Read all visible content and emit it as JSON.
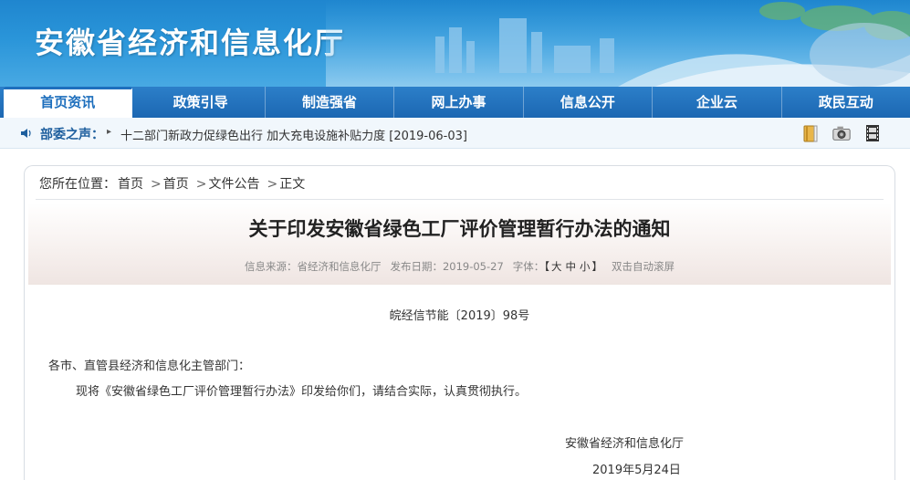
{
  "header": {
    "site_title": "安徽省经济和信息化厅"
  },
  "nav": {
    "items": [
      {
        "label": "首页资讯",
        "active": true
      },
      {
        "label": "政策引导",
        "active": false
      },
      {
        "label": "制造强省",
        "active": false
      },
      {
        "label": "网上办事",
        "active": false
      },
      {
        "label": "信息公开",
        "active": false
      },
      {
        "label": "企业云",
        "active": false
      },
      {
        "label": "政民互动",
        "active": false
      }
    ]
  },
  "ticker": {
    "label": "部委之声：",
    "arrow": "▸",
    "headline": "十二部门新政力促绿色出行 加大充电设施补贴力度 [2019-06-03]",
    "tools": [
      "book-icon",
      "camera-icon",
      "film-icon"
    ]
  },
  "breadcrumb": {
    "prefix": "您所在位置：",
    "items": [
      "首页",
      "首页",
      "文件公告",
      "正文"
    ],
    "separator": ">"
  },
  "article": {
    "title": "关于印发安徽省绿色工厂评价管理暂行办法的通知",
    "meta": {
      "source_label": "信息来源：",
      "source": "省经济和信息化厅",
      "date_label": "发布日期：",
      "date": "2019-05-27",
      "font_label": "字体：",
      "bracket_open": "【",
      "size_large": "大",
      "size_medium": "中",
      "size_small": "小",
      "bracket_close": "】",
      "autoscroll": "双击自动滚屏"
    },
    "doc_number": "皖经信节能〔2019〕98号",
    "salutation": "各市、直管县经济和信息化主管部门：",
    "body": "现将《安徽省绿色工厂评价管理暂行办法》印发给你们，请结合实际，认真贯彻执行。",
    "signature": "安徽省经济和信息化厅",
    "sign_date": "2019年5月24日"
  },
  "colors": {
    "banner": "#2a95d9",
    "nav": "#1c67b2",
    "ticker_label": "#1e5f9e"
  }
}
